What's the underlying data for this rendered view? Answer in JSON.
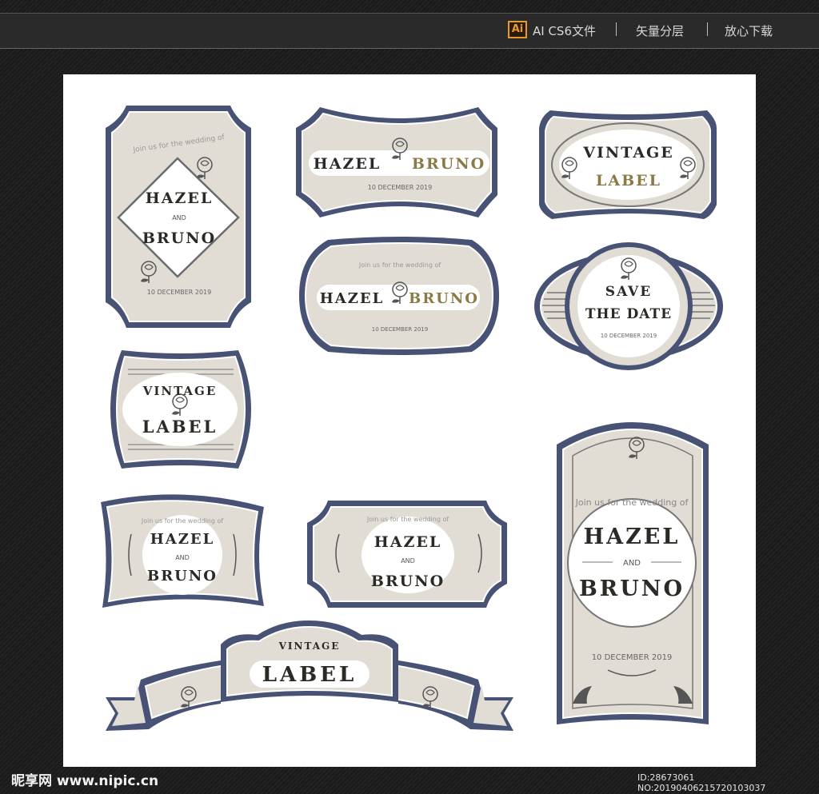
{
  "topbar": {
    "ai_icon": "Ai",
    "format": "AI CS6文件",
    "layers": "矢量分层",
    "download": "放心下载"
  },
  "labels": {
    "invite": "Join us for the wedding of",
    "bride": "HAZEL",
    "and": "AND",
    "groom": "BRUNO",
    "date": "10 DECEMBER 2019",
    "vintage": "VINTAGE",
    "label": "LABEL",
    "save": "SAVE",
    "the_date": "THE DATE"
  },
  "colors": {
    "navy": "#485274",
    "beige": "#e1ddd5",
    "gold": "#8a7a45",
    "text_dark": "#2b2a25"
  },
  "watermark": {
    "logo": "昵享网 www.nipic.cn",
    "id": "ID:28673061 NO:20190406215720103037"
  }
}
